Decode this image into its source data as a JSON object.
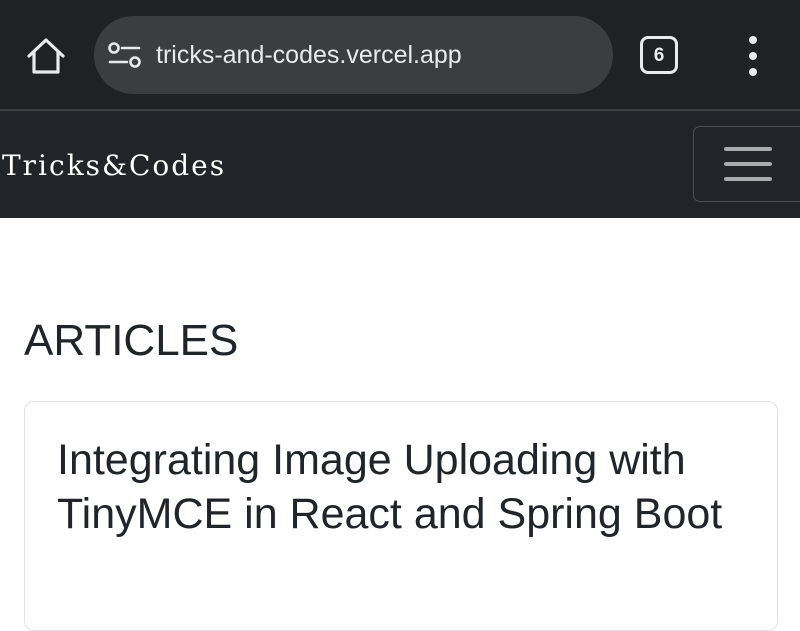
{
  "browser": {
    "url": "tricks-and-codes.vercel.app",
    "tab_count": "6",
    "home_icon": "home-icon",
    "site_info_icon": "tune-icon",
    "menu_icon": "more-vert-icon"
  },
  "navbar": {
    "brand": "Tricks&Codes",
    "toggler_icon": "hamburger-icon"
  },
  "main": {
    "section_heading": "ARTICLES",
    "articles": [
      {
        "title": "Integrating Image Uploading with TinyMCE in React and Spring Boot"
      }
    ]
  },
  "colors": {
    "chrome_bg": "#202124",
    "url_pill_bg": "#3c3d41",
    "navbar_bg": "#212529",
    "text_dark": "#212529",
    "card_border": "#dee2e6"
  }
}
